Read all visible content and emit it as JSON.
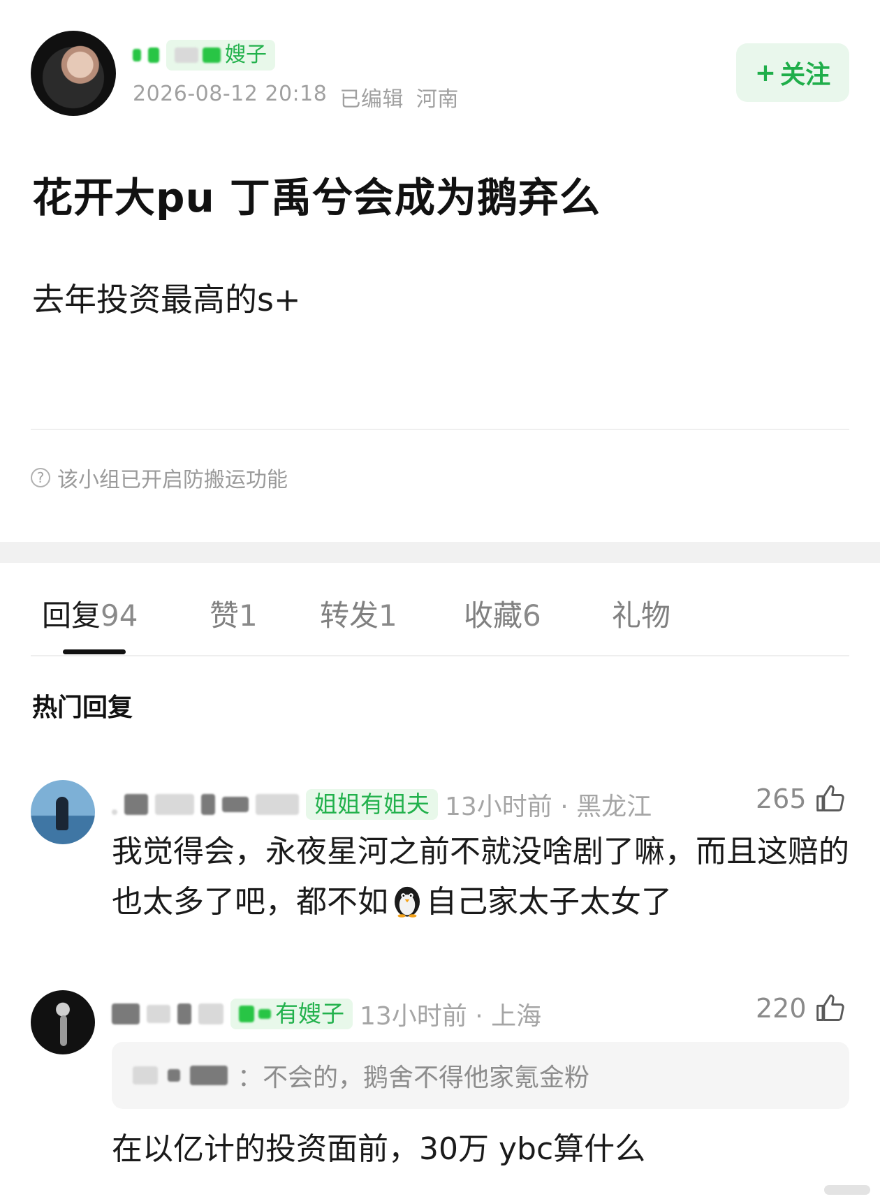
{
  "post": {
    "author_tag": "嫂子",
    "timestamp": "2026-08-12 20:18",
    "edited": "已编辑",
    "location": "河南",
    "follow_label": "关注",
    "follow_plus": "+",
    "title": "花开大pu 丁禹兮会成为鹅弃么",
    "body": "去年投资最高的s+",
    "notice": "该小组已开启防搬运功能",
    "notice_icon": "?"
  },
  "tabs": [
    {
      "label": "回复",
      "count": "94",
      "active": true
    },
    {
      "label": "赞",
      "count": "1",
      "active": false
    },
    {
      "label": "转发",
      "count": "1",
      "active": false
    },
    {
      "label": "收藏",
      "count": "6",
      "active": false
    },
    {
      "label": "礼物",
      "count": "",
      "active": false
    }
  ],
  "section_title": "热门回复",
  "comments": [
    {
      "tag": "姐姐有姐夫",
      "time_loc": "13小时前 · 黑龙江",
      "likes": "265",
      "text_before_emoji": "我觉得会，永夜星河之前不就没啥剧了嘛，而且这赔的也太多了吧，都不如",
      "emoji": "penguin",
      "text_after_emoji": "自己家太子太女了"
    },
    {
      "tag": "有嫂子",
      "time_loc": "13小时前 · 上海",
      "likes": "220",
      "quote_suffix": "：不会的，鹅舍不得他家氪金粉",
      "text": "在以亿计的投资面前，30万 ybc算什么"
    }
  ],
  "icons": {
    "thumb": "thumbs-up-icon",
    "info": "info-circle-icon"
  },
  "colors": {
    "accent_green": "#1fae4a",
    "tag_bg": "#e8f8ea"
  }
}
